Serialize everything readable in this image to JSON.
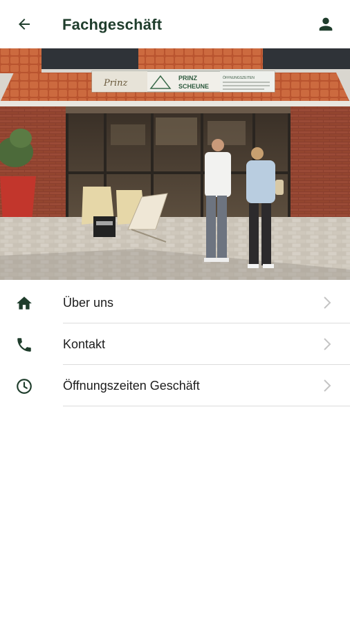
{
  "header": {
    "title": "Fachgeschäft",
    "back_icon": "arrow-left-icon",
    "profile_icon": "person-icon"
  },
  "hero": {
    "description_icon": "storefront-photo",
    "sign_left": "Prinz",
    "sign_center_line1": "PRINZ",
    "sign_center_line2": "SCHEUNE",
    "sign_right": "ÖFFNUNGSZEITEN"
  },
  "menu": {
    "items": [
      {
        "label": "Über uns",
        "icon": "home-icon"
      },
      {
        "label": "Kontakt",
        "icon": "phone-icon"
      },
      {
        "label": "Öffnungszeiten Geschäft",
        "icon": "clock-icon"
      }
    ]
  },
  "colors": {
    "accent": "#1f3d2c",
    "chevron": "#c4c4c4",
    "divider": "#dcdcdc"
  }
}
